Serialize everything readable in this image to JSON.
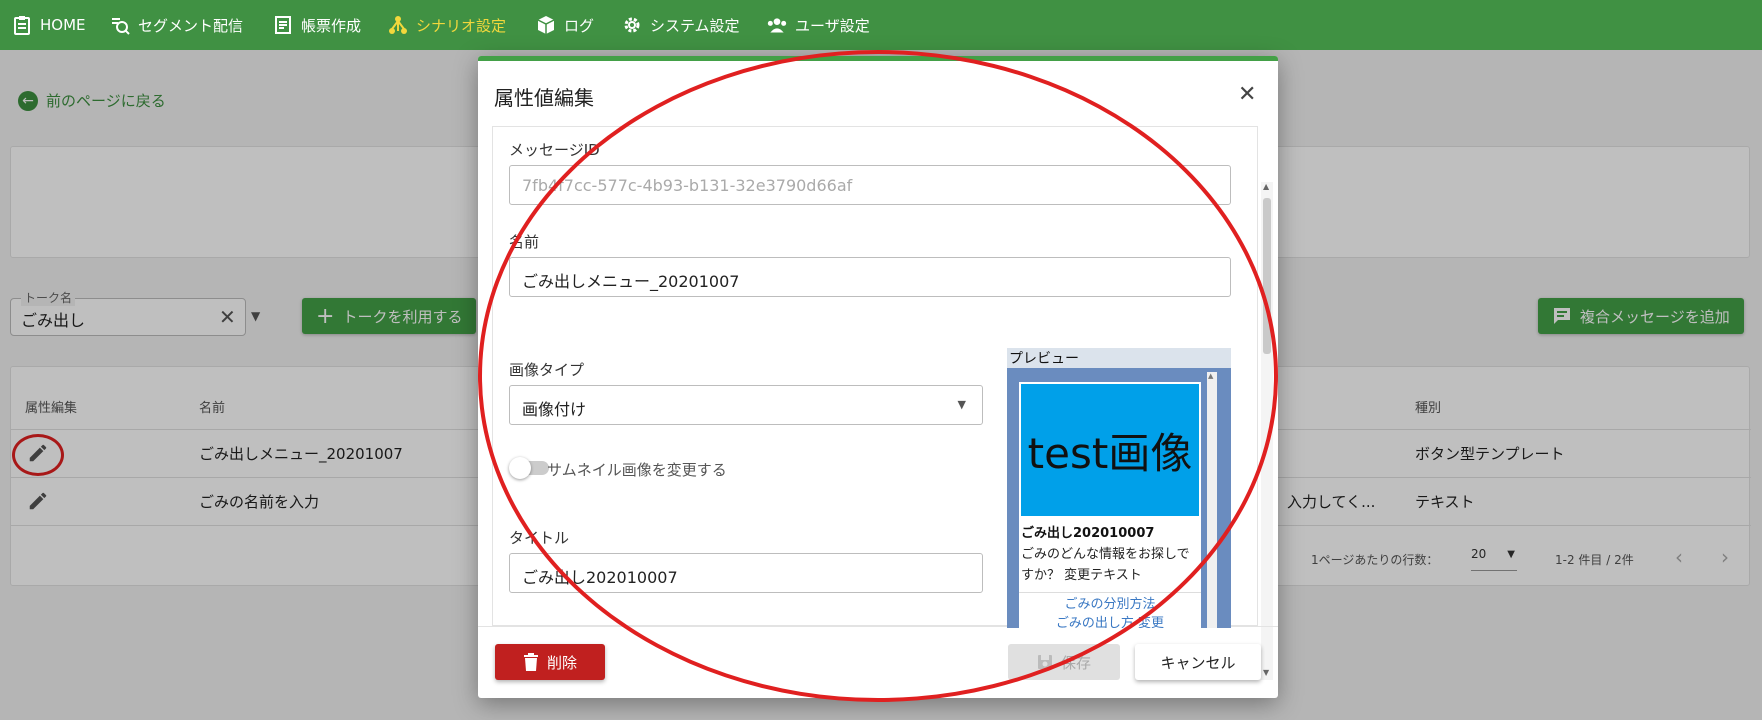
{
  "nav": {
    "items": [
      {
        "label": "HOME",
        "icon": "clipboard-icon"
      },
      {
        "label": "セグメント配信",
        "icon": "segment-icon"
      },
      {
        "label": "帳票作成",
        "icon": "document-icon"
      },
      {
        "label": "シナリオ設定",
        "icon": "scenario-icon"
      },
      {
        "label": "ログ",
        "icon": "cube-icon"
      },
      {
        "label": "システム設定",
        "icon": "gear-icon"
      },
      {
        "label": "ユーザ設定",
        "icon": "users-icon"
      }
    ]
  },
  "back_link": "前のページに戻る",
  "talk_select": {
    "label": "トーク名",
    "value": "ごみ出し"
  },
  "use_talk_button": "トークを利用する",
  "add_composite_button": "複合メッセージを追加",
  "table": {
    "headers": {
      "edit": "属性編集",
      "name": "名前",
      "type": "種別"
    },
    "rows": [
      {
        "name": "ごみ出しメニュー_20201007",
        "type": "ボタン型テンプレート",
        "extra": ""
      },
      {
        "name": "ごみの名前を入力",
        "type": "テキスト",
        "extra": "入力してく..."
      }
    ],
    "footer": {
      "rows_per_page_label": "1ページあたりの行数：",
      "rows_per_page": "20",
      "range": "1-2 件目 / 2件"
    }
  },
  "dialog": {
    "title": "属性値編集",
    "message_id_label": "メッセージID",
    "message_id_value": "7fb4f7cc-577c-4b93-b131-32e3790d66af",
    "name_label": "名前",
    "name_value": "ごみ出しメニュー_20201007",
    "image_type_label": "画像タイプ",
    "image_type_value": "画像付け",
    "thumbnail_toggle_label": "サムネイル画像を変更する",
    "title_label": "タイトル",
    "title_value": "ごみ出し202010007",
    "preview": {
      "header": "プレビュー",
      "image_text": "test画像",
      "title": "ごみ出し202010007",
      "text": "ごみのどんな情報をお探しですか？ 変更テキスト",
      "links": [
        "ごみの分別方法",
        "ごみの出し方 変更"
      ]
    },
    "delete_button": "削除",
    "save_button": "保存",
    "cancel_button": "キャンセル"
  },
  "colors": {
    "navbar": "#409143",
    "accent": "#43a047",
    "active_nav": "#f2d83c",
    "delete": "#c0201f",
    "annotation": "#e02020",
    "preview_image": "#00a0e9"
  }
}
